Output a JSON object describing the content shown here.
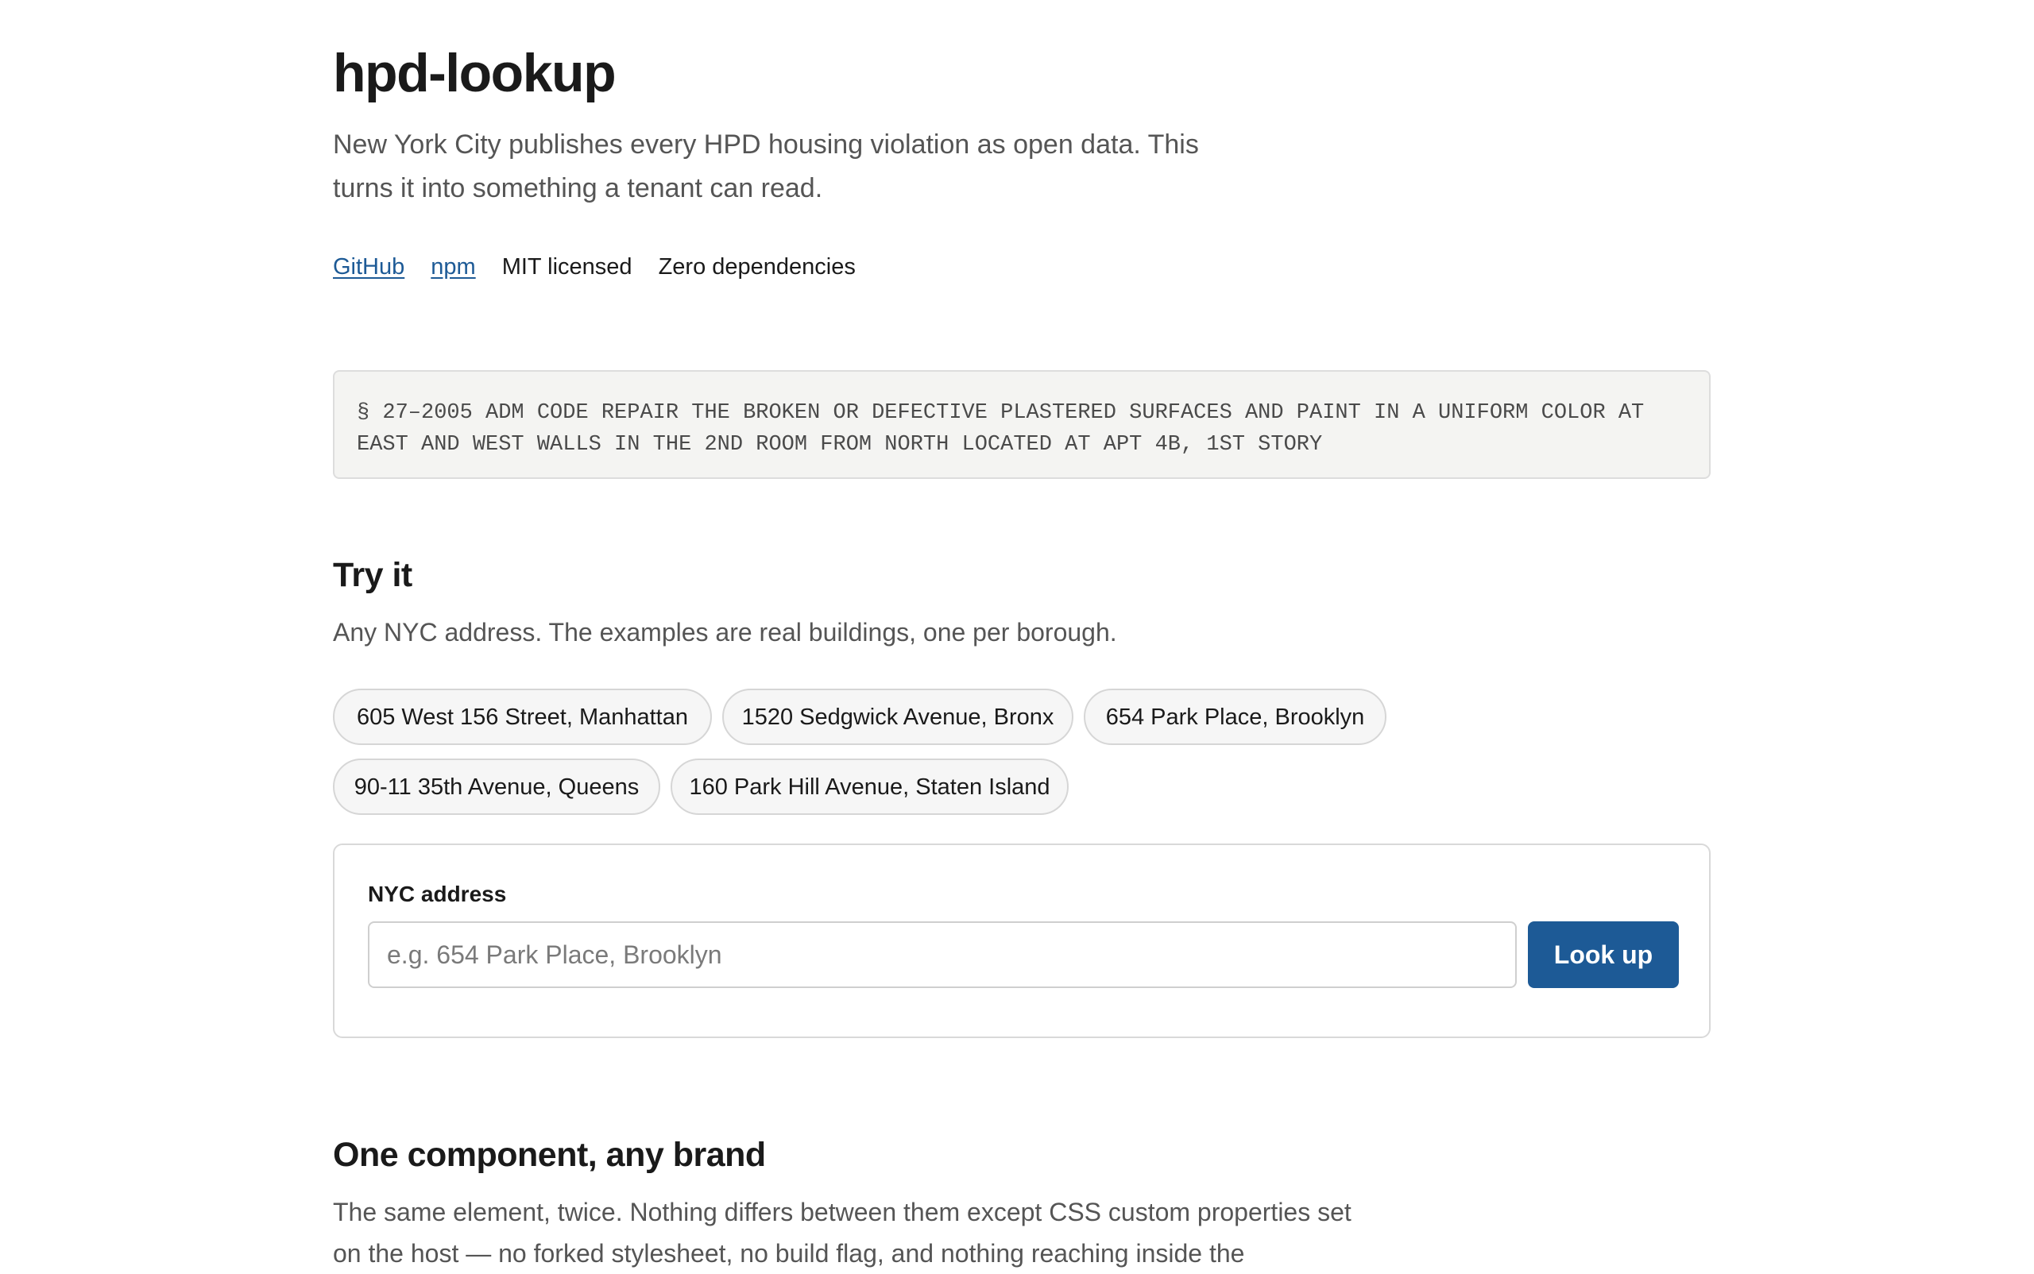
{
  "header": {
    "title": "hpd-lookup",
    "intro": "New York City publishes every HPD housing violation as open data. This turns it into something a tenant can read.",
    "links": {
      "github": "GitHub",
      "npm": "npm"
    },
    "badges": {
      "license": "MIT licensed",
      "dependencies": "Zero dependencies"
    }
  },
  "sample_violation": {
    "text": "§ 27–2005 ADM CODE REPAIR THE BROKEN OR DEFECTIVE PLASTERED SURFACES AND PAINT IN A UNIFORM COLOR AT EAST AND WEST WALLS IN THE 2ND ROOM FROM NORTH LOCATED AT APT 4B, 1ST STORY"
  },
  "try_it": {
    "title": "Try it",
    "description": "Any NYC address. The examples are real buildings, one per borough.",
    "examples": [
      "605 West 156 Street, Manhattan",
      "1520 Sedgwick Avenue, Bronx",
      "654 Park Place, Brooklyn",
      "90-11 35th Avenue, Queens",
      "160 Park Hill Avenue, Staten Island"
    ],
    "form": {
      "label": "NYC address",
      "placeholder": "e.g. 654 Park Place, Brooklyn",
      "value": "",
      "button_label": "Look up"
    }
  },
  "brand_section": {
    "title": "One component, any brand",
    "description": "The same element, twice. Nothing differs between them except CSS custom properties set on the host — no forked stylesheet, no build flag, and nothing reaching inside the"
  },
  "colors": {
    "accent": "#1d5a96",
    "text": "#1a1a1a",
    "muted": "#555555",
    "code_background": "#f4f4f2"
  }
}
